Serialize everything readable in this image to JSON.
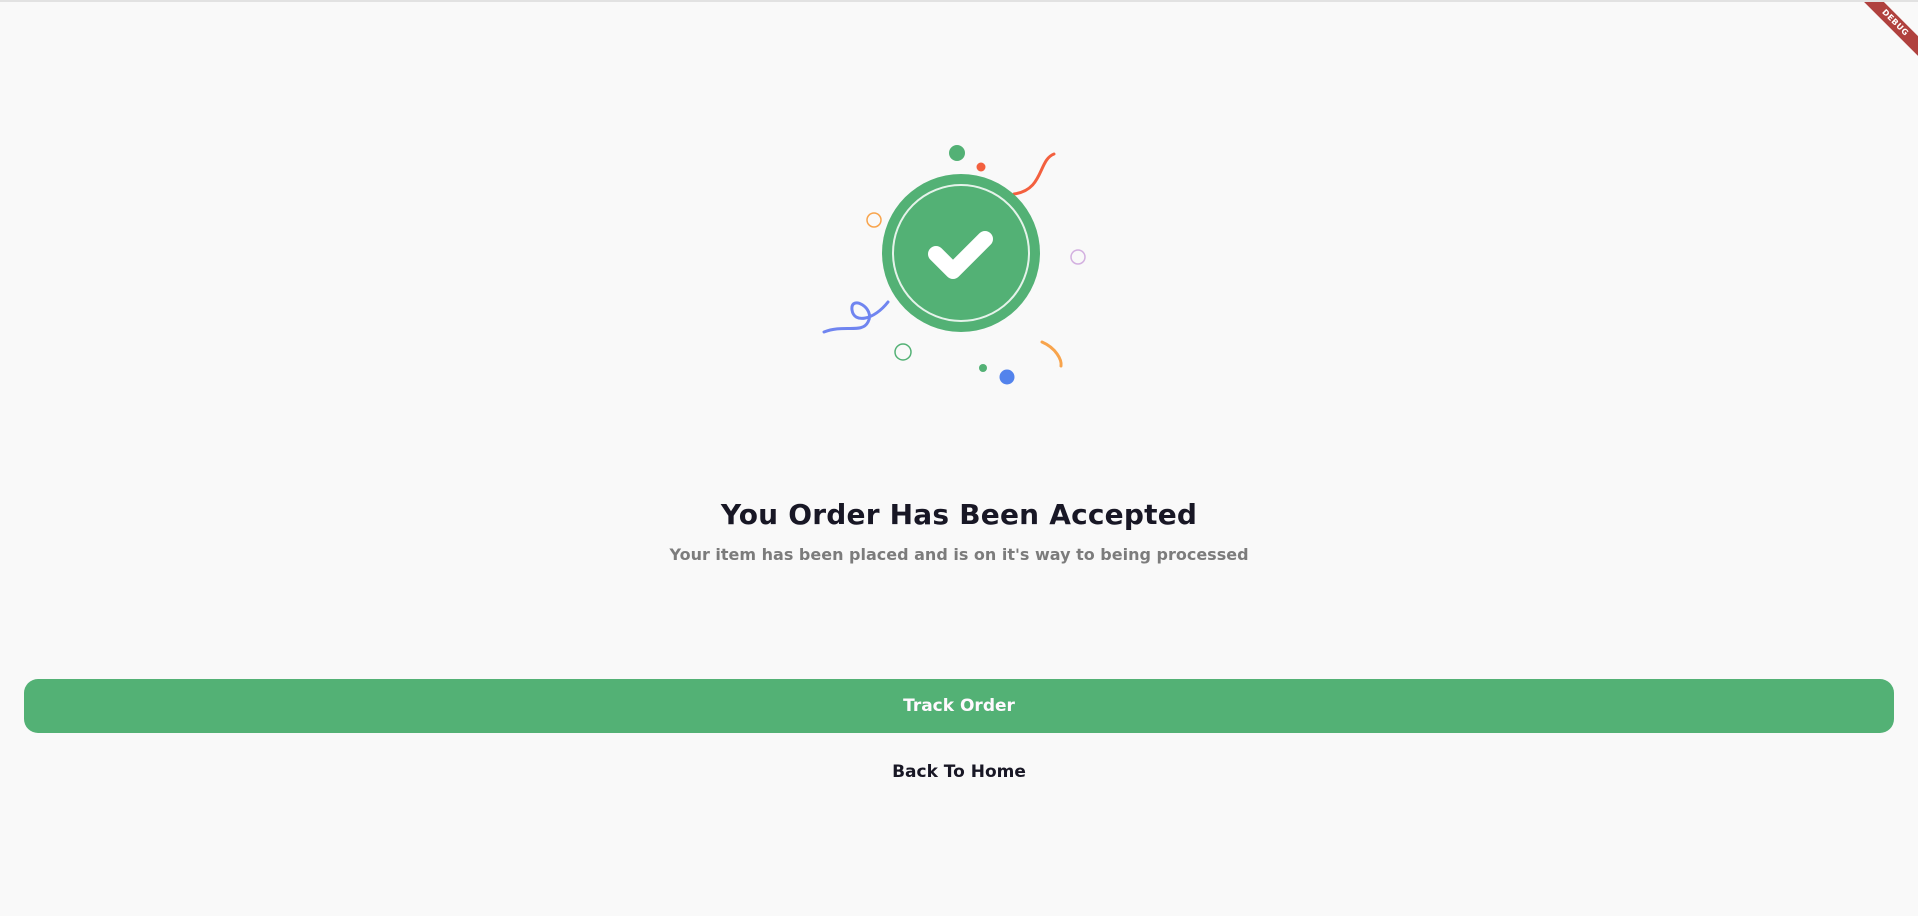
{
  "illustration": {
    "icon": "check-icon",
    "accent_color": "#53B175"
  },
  "message": {
    "title": "You Order Has Been Accepted",
    "subtitle": "Your item has been placed and is on it's way to being processed"
  },
  "actions": {
    "track_label": "Track Order",
    "home_label": "Back To Home"
  },
  "debug_banner": {
    "label": "DEBUG"
  }
}
